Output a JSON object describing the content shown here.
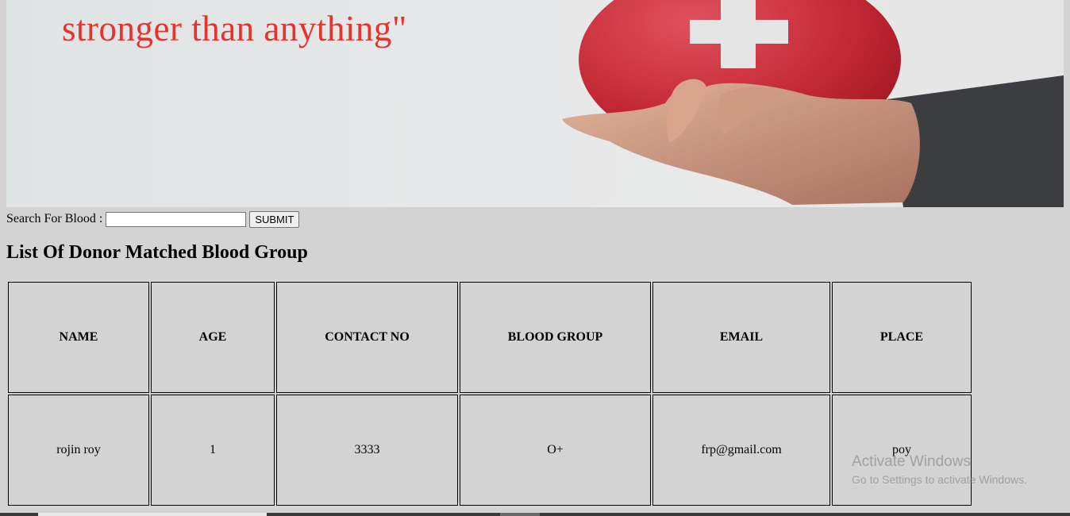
{
  "banner": {
    "text": "stronger than anything\""
  },
  "search": {
    "label": "Search For Blood :",
    "value": "",
    "placeholder": "",
    "submit_label": "SUBMIT"
  },
  "list_title": "List Of Donor Matched Blood Group",
  "table": {
    "headers": [
      "NAME",
      "AGE",
      "CONTACT NO",
      "BLOOD GROUP",
      "EMAIL",
      "PLACE"
    ],
    "rows": [
      [
        "rojin roy",
        "1",
        "3333",
        "O+",
        "frp@gmail.com",
        "poy"
      ]
    ]
  },
  "watermark": {
    "title": "Activate Windows",
    "subtitle": "Go to Settings to activate Windows."
  }
}
